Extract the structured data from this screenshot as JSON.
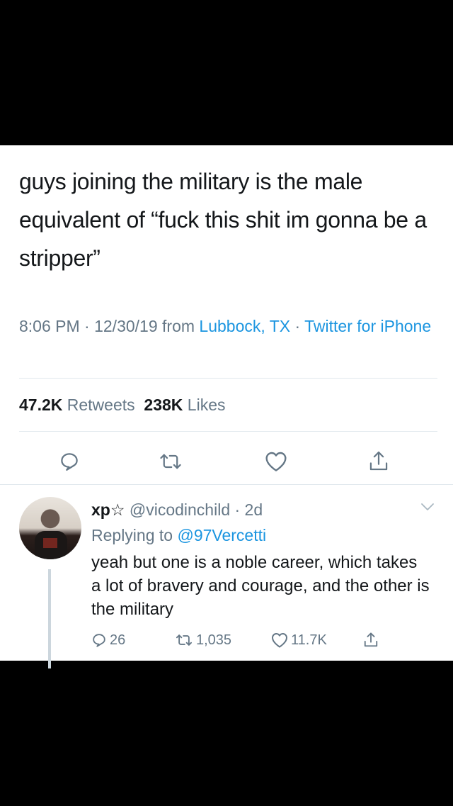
{
  "tweet": {
    "text": "guys joining the military is the male equivalent of “fuck this shit im gonna be a stripper”",
    "time": "8:06 PM · 12/30/19 from ",
    "location": "Lubbock, TX",
    "sep": " · ",
    "client": "Twitter for iPhone",
    "retweets_count": "47.2K",
    "retweets_label": " Retweets",
    "likes_count": "238K",
    "likes_label": " Likes"
  },
  "reply": {
    "display_name": "xp☆",
    "handle": " @vicodinchild · 2d",
    "replying_prefix": "Replying to ",
    "replying_to": "@97Vercetti",
    "text": "yeah but one is a noble career, which takes a lot of bravery and courage, and the other is the military",
    "reply_count": "26",
    "retweet_count": "1,035",
    "like_count": "11.7K"
  },
  "colors": {
    "text": "#14171a",
    "secondary": "#657786",
    "link": "#1b95e0",
    "divider": "#e1e8ed"
  },
  "icons": [
    "reply-icon",
    "retweet-icon",
    "like-icon",
    "share-icon",
    "chevron-down-icon"
  ]
}
